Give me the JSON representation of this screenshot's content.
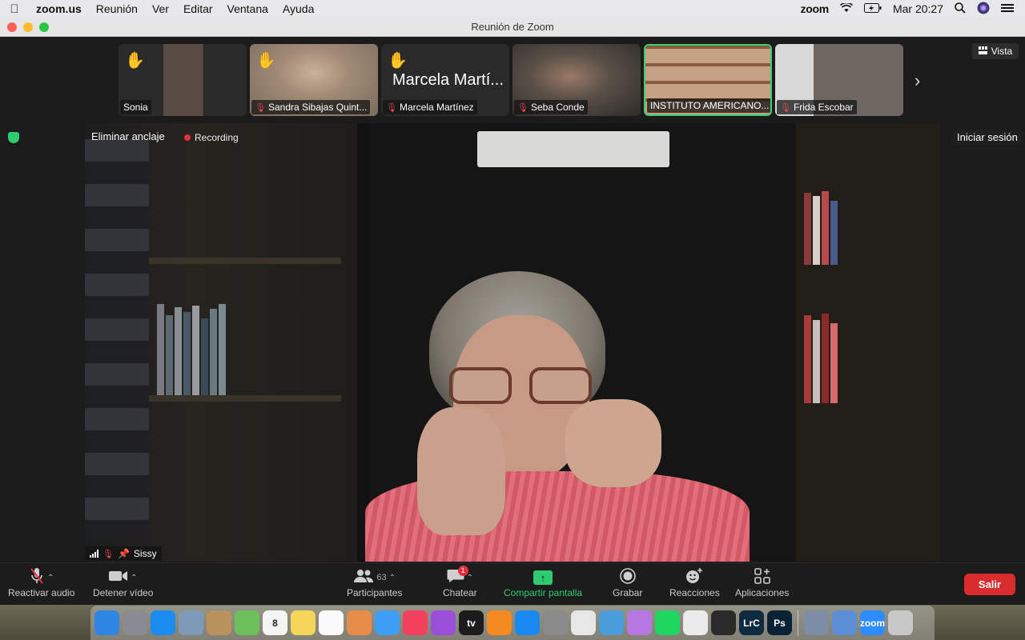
{
  "menubar": {
    "app_name": "zoom.us",
    "menus": [
      "Reunión",
      "Ver",
      "Editar",
      "Ventana",
      "Ayuda"
    ],
    "zoom_status": "zoom",
    "clock": "Mar 20:27"
  },
  "window": {
    "title": "Reunión de Zoom"
  },
  "gallery": {
    "tiles": [
      {
        "name": "Sonia",
        "hand_raised": true,
        "muted": false,
        "active": false,
        "big_name": ""
      },
      {
        "name": "Sandra Sibajas Quint...",
        "hand_raised": true,
        "muted": true,
        "active": false,
        "big_name": ""
      },
      {
        "name": "Marcela Martínez",
        "hand_raised": true,
        "muted": true,
        "active": false,
        "big_name": "Marcela Martí..."
      },
      {
        "name": "Seba Conde",
        "hand_raised": false,
        "muted": true,
        "active": false,
        "big_name": ""
      },
      {
        "name": "INSTITUTO AMERICANO...",
        "hand_raised": false,
        "muted": false,
        "active": true,
        "big_name": ""
      },
      {
        "name": "Frida Escobar",
        "hand_raised": false,
        "muted": true,
        "active": false,
        "big_name": ""
      }
    ],
    "view_label": "Vista"
  },
  "main": {
    "unpin_label": "Eliminar anclaje",
    "recording_label": "Recording",
    "signin_label": "Iniciar sesión",
    "speaker_name": "Sissy"
  },
  "toolbar": {
    "unmute_label": "Reactivar audio",
    "stop_video_label": "Detener vídeo",
    "participants_label": "Participantes",
    "participants_count": "63",
    "chat_label": "Chatear",
    "chat_badge": "1",
    "share_label": "Compartir pantalla",
    "record_label": "Grabar",
    "reactions_label": "Reacciones",
    "apps_label": "Aplicaciones",
    "leave_label": "Salir"
  },
  "dock": {
    "icons": [
      {
        "name": "finder",
        "label": "",
        "color": "#2f86e5"
      },
      {
        "name": "launchpad",
        "label": "",
        "color": "#8a8a92"
      },
      {
        "name": "safari",
        "label": "",
        "color": "#1a8cf0"
      },
      {
        "name": "preview",
        "label": "",
        "color": "#7d9ab8"
      },
      {
        "name": "contacts",
        "label": "",
        "color": "#b9925e"
      },
      {
        "name": "maps",
        "label": "",
        "color": "#6cbf5b"
      },
      {
        "name": "calendar",
        "label": "8",
        "color": "#f5f5f5"
      },
      {
        "name": "notes",
        "label": "",
        "color": "#f4d65a"
      },
      {
        "name": "reminders",
        "label": "",
        "color": "#fafafa"
      },
      {
        "name": "photos",
        "label": "",
        "color": "#e88c4a"
      },
      {
        "name": "messages",
        "label": "",
        "color": "#3d9ef5"
      },
      {
        "name": "music",
        "label": "",
        "color": "#f2405d"
      },
      {
        "name": "podcasts",
        "label": "",
        "color": "#9b4fd9"
      },
      {
        "name": "apple-tv",
        "label": "tv",
        "color": "#1c1c1c"
      },
      {
        "name": "books",
        "label": "",
        "color": "#f58b20"
      },
      {
        "name": "app-store",
        "label": "",
        "color": "#1b8af0"
      },
      {
        "name": "system-preferences",
        "label": "",
        "color": "#8a8a8a"
      },
      {
        "name": "chrome",
        "label": "",
        "color": "#e7e7e7"
      },
      {
        "name": "screen-utility",
        "label": "",
        "color": "#4a9dd8"
      },
      {
        "name": "feedback",
        "label": "",
        "color": "#b678e0"
      },
      {
        "name": "spotify",
        "label": "",
        "color": "#1ed760"
      },
      {
        "name": "textedit",
        "label": "",
        "color": "#eaeaea"
      },
      {
        "name": "utility",
        "label": "",
        "color": "#2a2a2a"
      },
      {
        "name": "lightroom",
        "label": "LrC",
        "color": "#0d2a3f"
      },
      {
        "name": "photoshop",
        "label": "Ps",
        "color": "#0b2236"
      }
    ],
    "right_icons": [
      {
        "name": "image-capture",
        "label": "",
        "color": "#7b8ea6"
      },
      {
        "name": "migration",
        "label": "",
        "color": "#5b8ed6"
      },
      {
        "name": "zoom",
        "label": "zoom",
        "color": "#2d8cff"
      },
      {
        "name": "trash",
        "label": "",
        "color": "#c8c8c8"
      }
    ]
  }
}
